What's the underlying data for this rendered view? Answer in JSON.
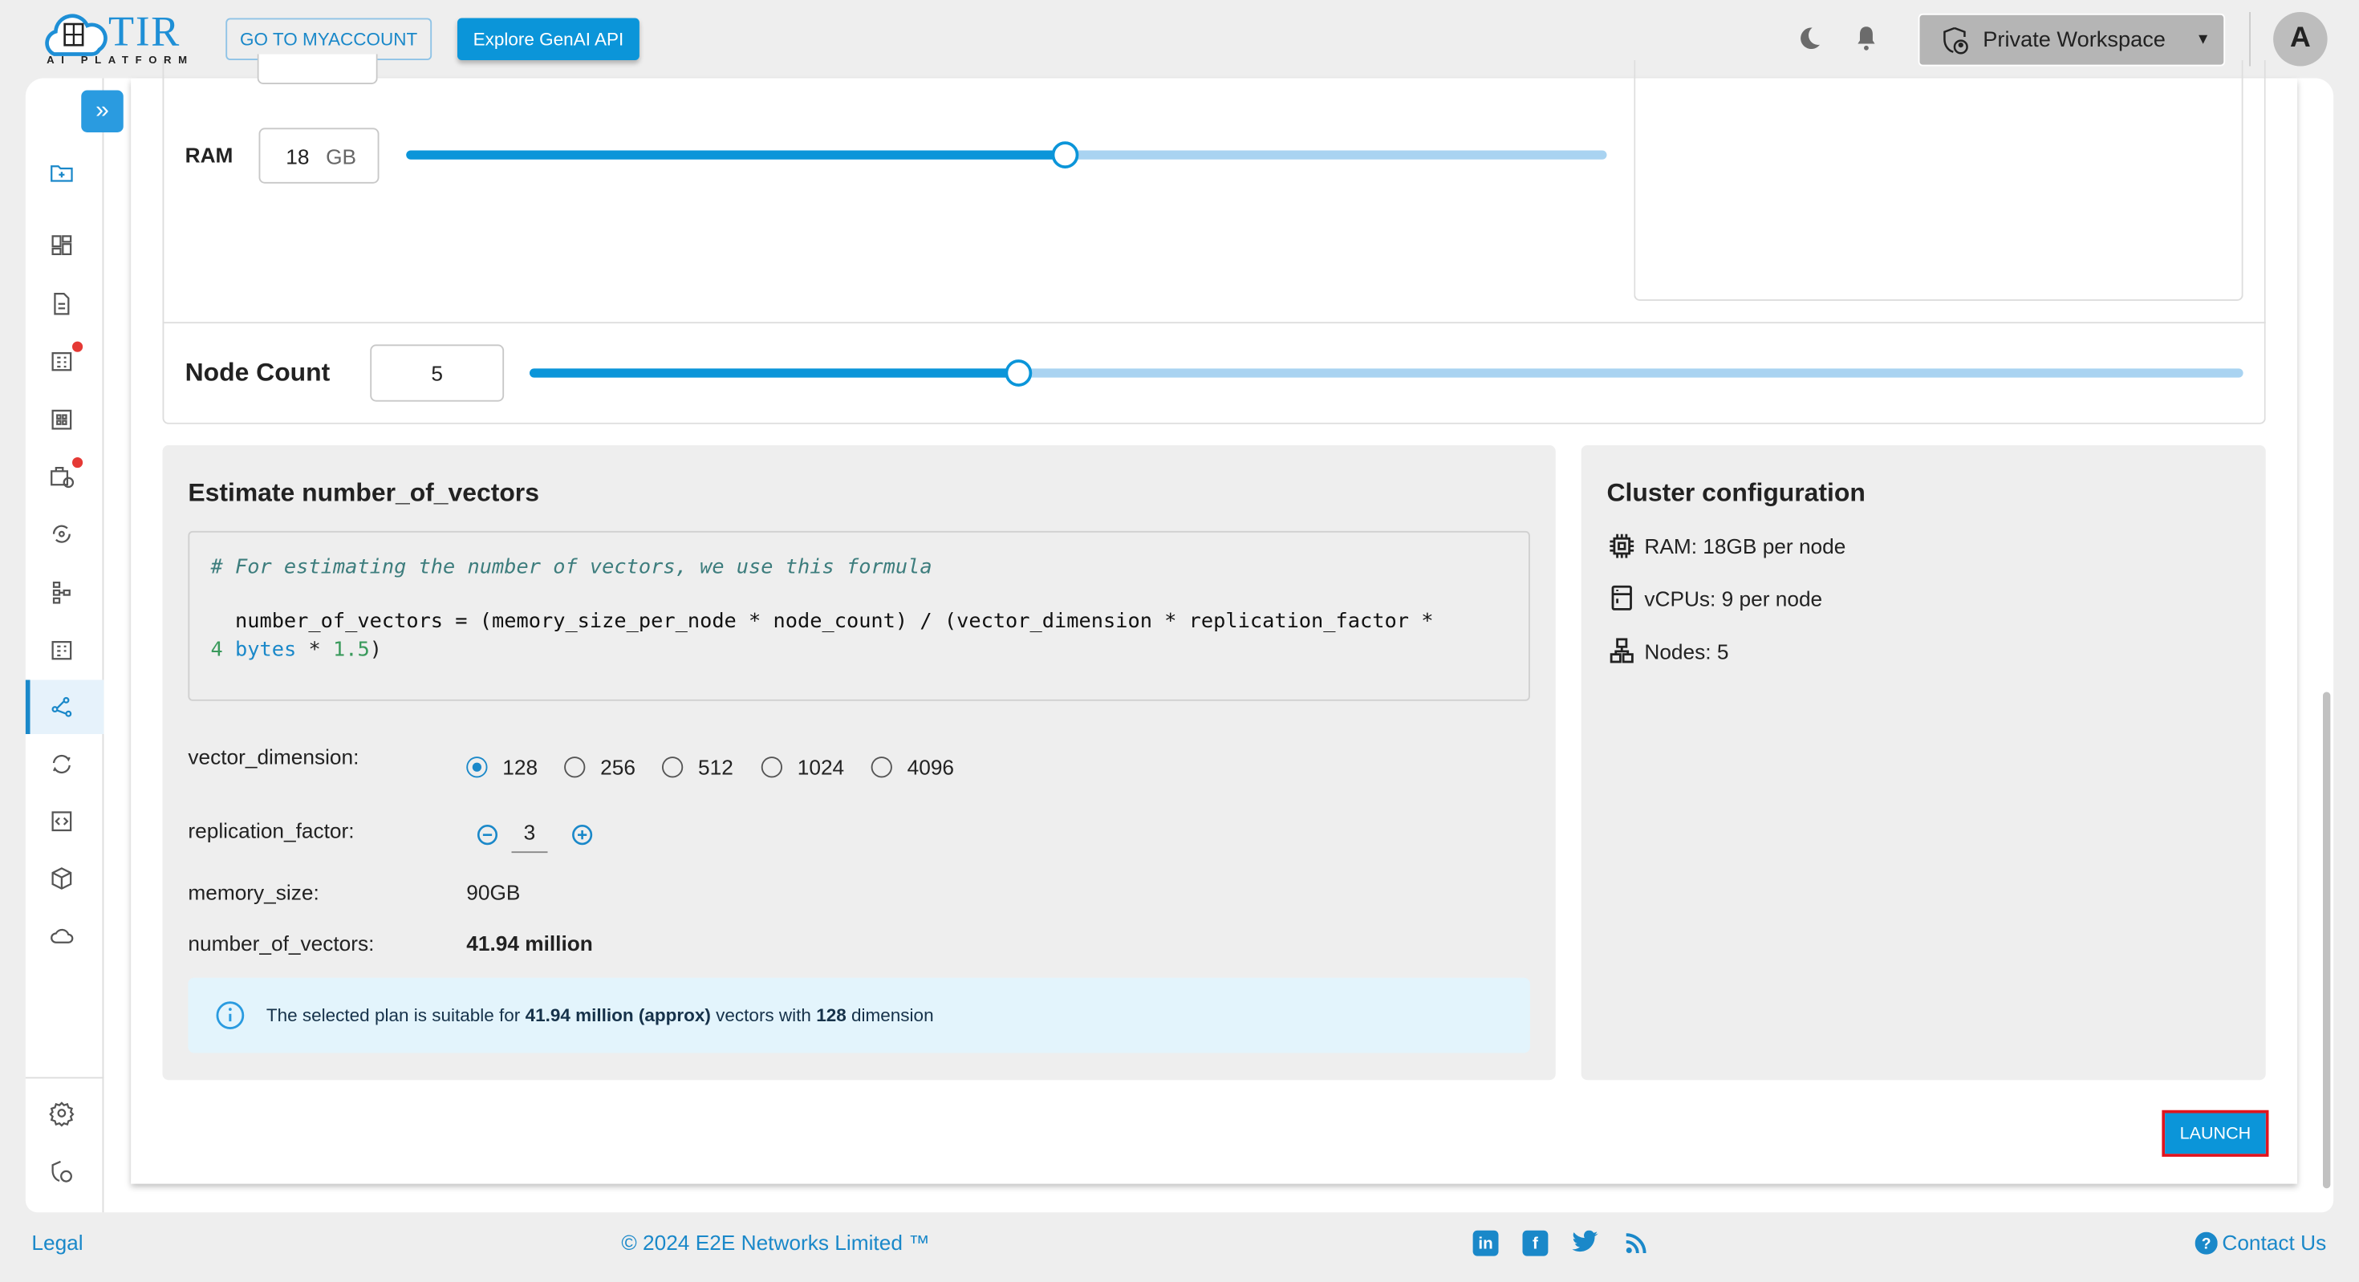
{
  "header": {
    "logo_text": "TIR",
    "logo_sub": "AI PLATFORM",
    "logo_badge": "E2E Cloud",
    "myaccount_label": "GO TO MYACCOUNT",
    "genai_label": "Explore GenAI API",
    "workspace_label": "Private Workspace",
    "avatar_initial": "A"
  },
  "sidebar": {
    "icons": [
      "folder-plus-icon",
      "dashboard-icon",
      "document-icon",
      "reports-icon",
      "grid-icon",
      "briefcase-clock-icon",
      "refresh-pin-icon",
      "hierarchy-icon",
      "table-icon",
      "vector-db-icon",
      "sync-icon",
      "code-icon",
      "cube-icon",
      "cloud-icon",
      "settings-icon",
      "shield-user-icon"
    ],
    "active": "vector-db-icon"
  },
  "config": {
    "ram_label": "RAM",
    "ram_value": "18",
    "ram_unit": "GB",
    "ram_slider_fraction": 0.549,
    "node_count_label": "Node Count",
    "node_count_value": "5",
    "node_slider_fraction": 0.285
  },
  "estimate": {
    "title": "Estimate number_of_vectors",
    "code_comment": "# For estimating the number of vectors, we use this formula",
    "code_line1": "  number_of_vectors = (memory_size_per_node * node_count) / (vector_dimension * replication_factor *",
    "code_num4": "4",
    "code_bytes": "bytes",
    "code_mul": " * ",
    "code_num15": "1.5",
    "code_close": ")",
    "vector_dimension_label": "vector_dimension:",
    "vector_dimension_options": [
      "128",
      "256",
      "512",
      "1024",
      "4096"
    ],
    "vector_dimension_selected": "128",
    "replication_factor_label": "replication_factor:",
    "replication_factor_value": "3",
    "memory_size_label": "memory_size:",
    "memory_size_value": "90GB",
    "number_of_vectors_label": "number_of_vectors:",
    "number_of_vectors_value": "41.94 million",
    "info_pre": "The selected plan is suitable for ",
    "info_bold1": "41.94 million (approx)",
    "info_mid": " vectors with ",
    "info_bold2": "128",
    "info_post": " dimension"
  },
  "cluster": {
    "title": "Cluster configuration",
    "ram": "RAM: 18GB per node",
    "vcpus": "vCPUs: 9 per node",
    "nodes": "Nodes: 5"
  },
  "launch_label": "LAUNCH",
  "footer": {
    "legal": "Legal",
    "copyright": "© 2024 E2E Networks Limited ™",
    "social": [
      "linkedin-icon",
      "facebook-icon",
      "twitter-icon",
      "rss-icon"
    ],
    "contact": "Contact Us"
  },
  "colors": {
    "accent": "#0b95d9",
    "link": "#1a88c9",
    "highlight": "#e0141e",
    "info_bg": "#e3f4fc"
  }
}
